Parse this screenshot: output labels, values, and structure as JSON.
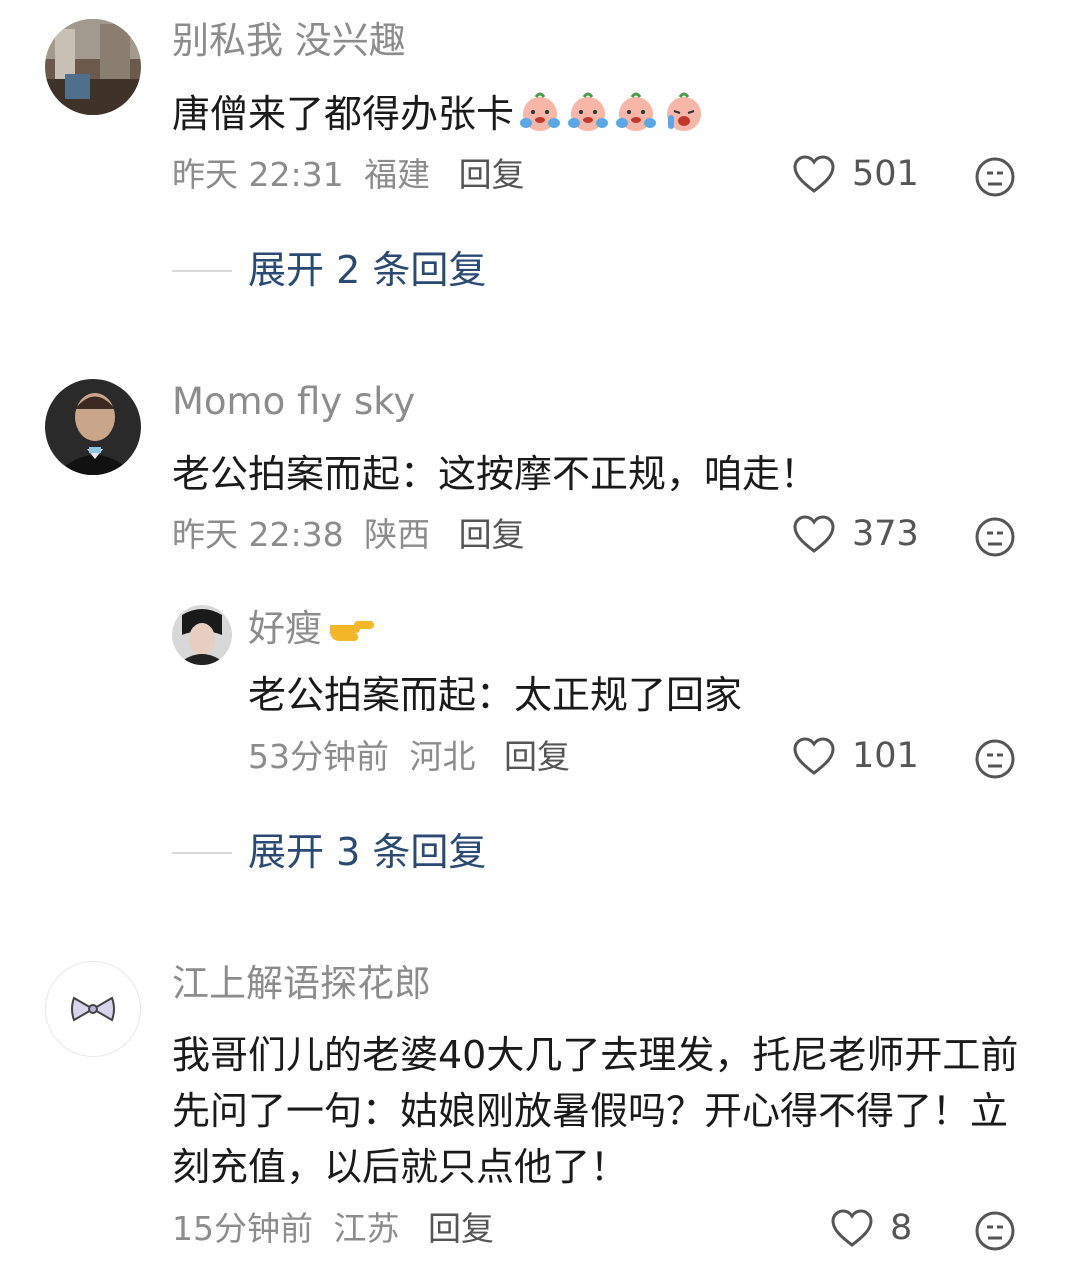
{
  "comments": [
    {
      "username": "别私我 没兴趣",
      "text": "唐僧来了都得办张卡",
      "emoji_names": [
        "peach-crying-icon",
        "peach-crying-icon",
        "peach-crying-icon",
        "peach-sobbing-icon"
      ],
      "time": "昨天 22:31",
      "location": "福建",
      "reply_label": "回复",
      "likes": "501",
      "expand_label": "展开 2 条回复"
    },
    {
      "username": "Momo fly sky",
      "text": "老公拍案而起：这按摩不正规，咱走！",
      "time": "昨天 22:38",
      "location": "陕西",
      "reply_label": "回复",
      "likes": "373",
      "reply": {
        "username": "好瘦",
        "username_emoji": "pointing-hand-icon",
        "text": "老公拍案而起：太正规了回家",
        "time": "53分钟前",
        "location": "河北",
        "reply_label": "回复",
        "likes": "101"
      },
      "expand_label": "展开 3 条回复"
    },
    {
      "username": "江上解语探花郎",
      "text": "我哥们儿的老婆40大几了去理发，托尼老师开工前先问了一句：姑娘刚放暑假吗？开心得不得了！立刻充值，以后就只点他了！",
      "time": "15分钟前",
      "location": "江苏",
      "reply_label": "回复",
      "likes": "8"
    }
  ],
  "colors": {
    "username": "#8c8c8c",
    "text": "#1a1a1a",
    "expand_link": "#2b4a73",
    "icon_gray": "#555555"
  }
}
